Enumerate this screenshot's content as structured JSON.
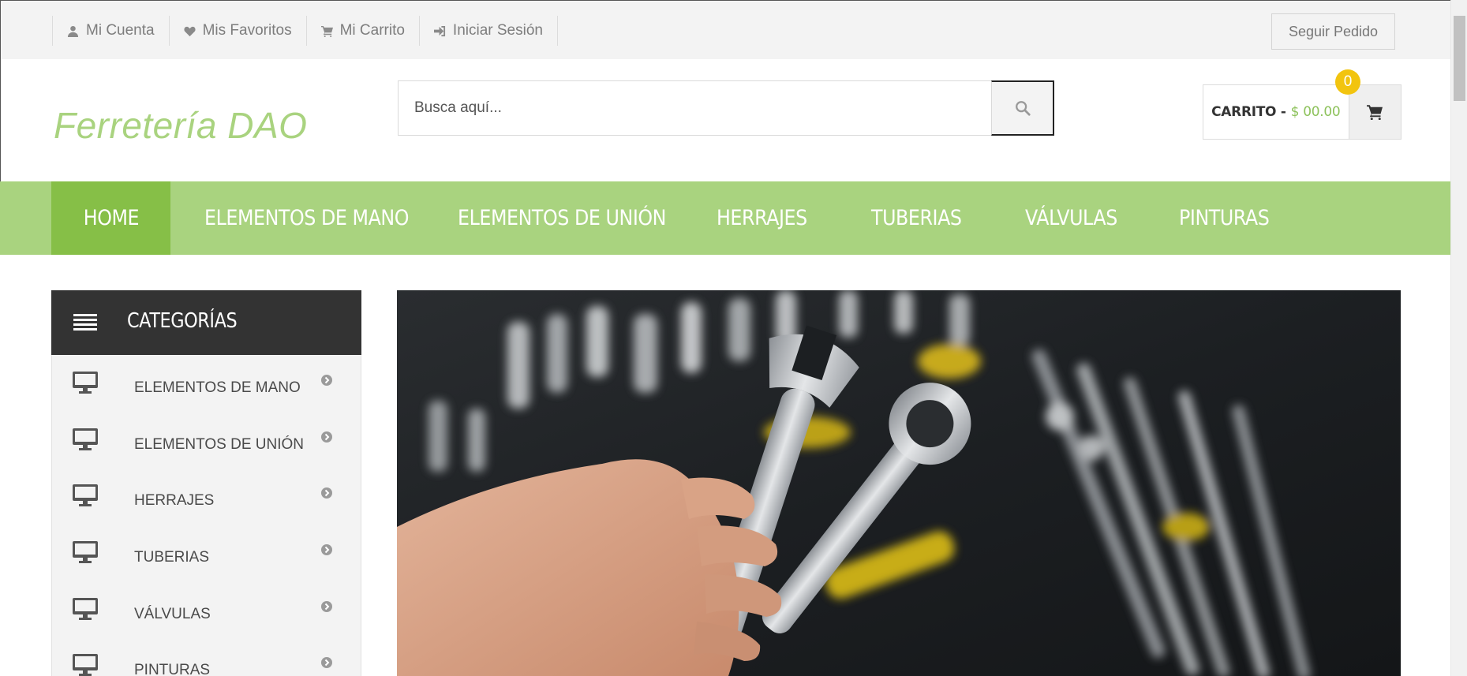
{
  "topbar": {
    "links": [
      {
        "label": "Mi Cuenta",
        "icon": "user-icon"
      },
      {
        "label": "Mis Favoritos",
        "icon": "heart-icon"
      },
      {
        "label": "Mi Carrito",
        "icon": "cart-icon"
      },
      {
        "label": "Iniciar Sesión",
        "icon": "sign-in-icon"
      }
    ],
    "track_order": "Seguir Pedido"
  },
  "header": {
    "logo": "Ferretería DAO",
    "search": {
      "placeholder": "Busca aquí..."
    },
    "cart": {
      "label": "CARRITO -",
      "amount": "$ 00.00",
      "count": "0"
    }
  },
  "nav": {
    "items": [
      {
        "label": "HOME",
        "active": true
      },
      {
        "label": "ELEMENTOS DE MANO"
      },
      {
        "label": "ELEMENTOS DE UNIÓN"
      },
      {
        "label": "HERRAJES"
      },
      {
        "label": "TUBERIAS"
      },
      {
        "label": "VÁLVULAS"
      },
      {
        "label": "PINTURAS"
      }
    ]
  },
  "sidebar": {
    "title": "CATEGORÍAS",
    "items": [
      {
        "label": "ELEMENTOS DE MANO"
      },
      {
        "label": "ELEMENTOS DE UNIÓN"
      },
      {
        "label": "HERRAJES"
      },
      {
        "label": "TUBERIAS"
      },
      {
        "label": "VÁLVULAS"
      },
      {
        "label": "PINTURAS"
      }
    ]
  },
  "hero": {
    "image": "hand holding two wrenches over a toolbox"
  },
  "colors": {
    "accent": "#a9d37f",
    "accent_dark": "#86bf47",
    "price": "#8dc25b",
    "badge": "#f2c40f",
    "dark": "#333333"
  }
}
